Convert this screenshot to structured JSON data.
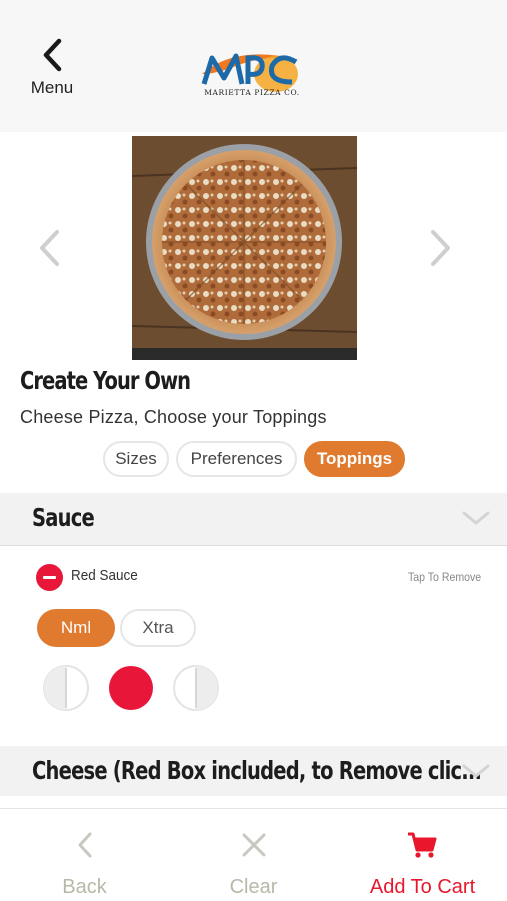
{
  "header": {
    "menu_label": "Menu",
    "logo_text": "MPC",
    "logo_subtext": "MARIETTA PIZZA CO."
  },
  "item": {
    "title": "Create Your Own",
    "subtitle": "Cheese Pizza, Choose your Toppings"
  },
  "tabs": [
    {
      "label": "Sizes",
      "active": false
    },
    {
      "label": "Preferences",
      "active": false
    },
    {
      "label": "Toppings",
      "active": true
    }
  ],
  "sections": {
    "sauce": {
      "title": "Sauce",
      "topping_name": "Red Sauce",
      "action_hint": "Tap To Remove",
      "amounts": [
        {
          "label": "Nml",
          "selected": true
        },
        {
          "label": "Xtra",
          "selected": false
        }
      ],
      "portion_selected": "whole"
    },
    "cheese": {
      "title": "Cheese (Red Box included, to Remove clic..."
    }
  },
  "bottom_nav": {
    "back_label": "Back",
    "clear_label": "Clear",
    "cart_label": "Add To Cart"
  },
  "colors": {
    "accent_orange": "#e07a2e",
    "remove_red": "#e8173a",
    "cart_red": "#e8172c",
    "disabled_gray": "#b8b8a8"
  },
  "icons": {
    "menu": "chevron-left-icon",
    "prev": "chevron-left-icon",
    "next": "chevron-right-icon",
    "collapse": "chevron-down-icon",
    "remove": "minus-circle-icon",
    "back": "chevron-left-icon",
    "clear": "close-icon",
    "cart": "shopping-cart-icon"
  }
}
